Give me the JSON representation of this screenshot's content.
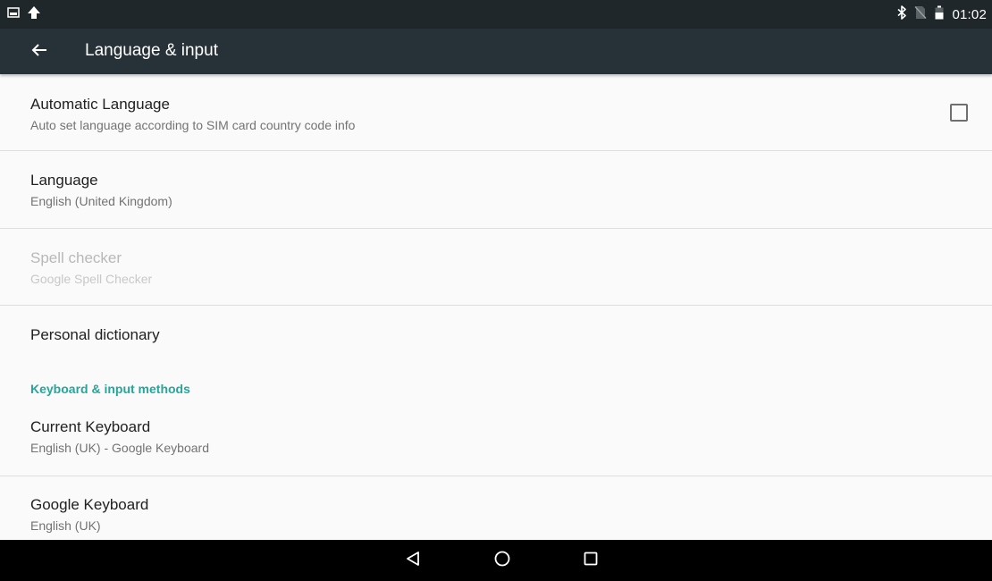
{
  "status_bar": {
    "left_icons": [
      "image-notification-icon",
      "upload-arrow-icon"
    ],
    "right_icons": [
      "bluetooth-icon",
      "no-sim-icon",
      "battery-icon"
    ],
    "time": "01:02"
  },
  "toolbar": {
    "back_icon": "back-arrow-icon",
    "title": "Language & input",
    "background_color": "#263238"
  },
  "items": [
    {
      "title": "Automatic Language",
      "summary": "Auto set language according to SIM card country code info",
      "widget": "checkbox",
      "checked": false
    },
    {
      "title": "Language",
      "summary": "English (United Kingdom)"
    },
    {
      "title": "Spell checker",
      "summary": "Google Spell Checker",
      "enabled": false
    },
    {
      "title": "Personal dictionary"
    }
  ],
  "category": {
    "label": "Keyboard & input methods",
    "color": "#26a69a"
  },
  "keyboard_items": [
    {
      "title": "Current Keyboard",
      "summary": "English (UK) - Google Keyboard"
    },
    {
      "title": "Google Keyboard",
      "summary": "English (UK)"
    }
  ],
  "nav_bar": {
    "buttons": [
      "back-triangle-icon",
      "home-circle-icon",
      "recents-square-icon"
    ]
  }
}
